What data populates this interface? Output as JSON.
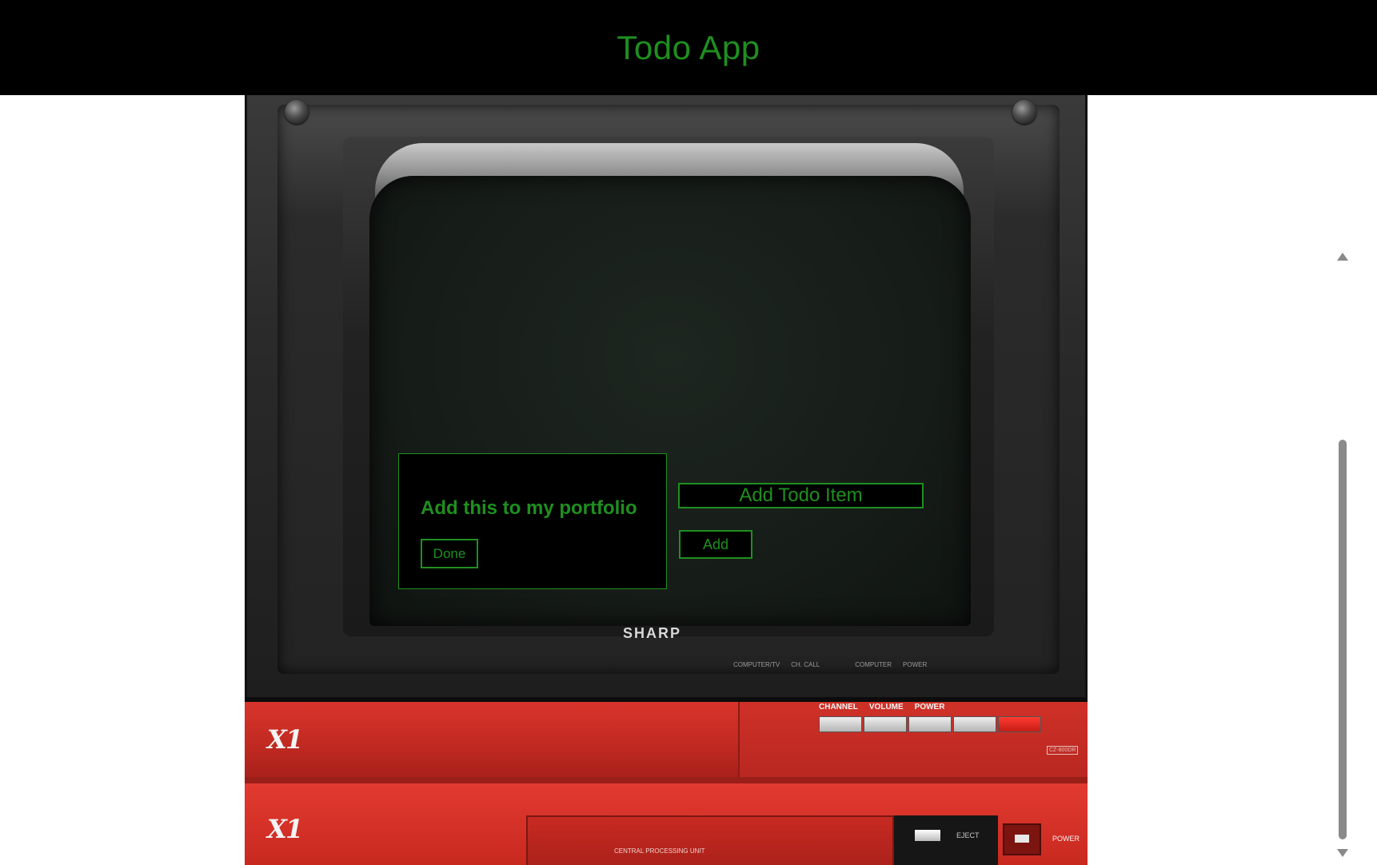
{
  "header": {
    "title": "Todo App"
  },
  "computer": {
    "brand": "SHARP",
    "logo": "X1",
    "control_labels": [
      "COMPUTER/TV",
      "CH. CALL",
      "COMPUTER",
      "POWER"
    ],
    "base_labels": [
      "CHANNEL",
      "VOLUME",
      "POWER"
    ],
    "model": "CZ-800DR",
    "cpu_label": "CENTRAL PROCESSING UNIT",
    "eject_label": "EJECT",
    "cpu_power_label": "POWER"
  },
  "todo": {
    "item_text": "Add this to my portfolio",
    "done_label": "Done",
    "input_placeholder": "Add Todo Item",
    "add_label": "Add"
  },
  "colors": {
    "accent": "#1f8f1f",
    "header_bg": "#000000",
    "page_bg": "#ffffff"
  },
  "icons": {
    "scroll_up": "triangle-up-icon",
    "scroll_down": "triangle-down-icon"
  }
}
